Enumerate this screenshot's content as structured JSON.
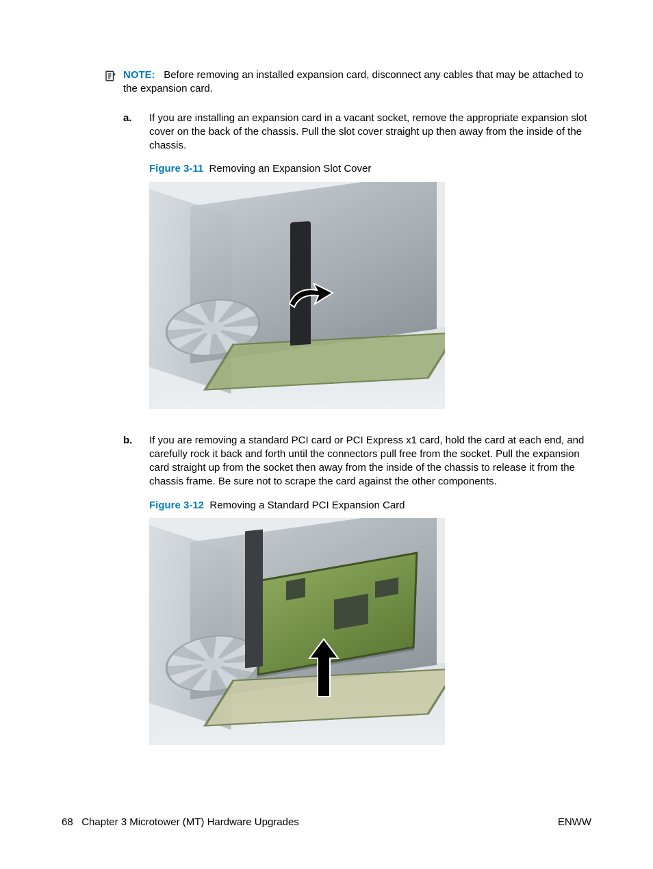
{
  "note": {
    "label": "NOTE:",
    "text": "Before removing an installed expansion card, disconnect any cables that may be attached to the expansion card."
  },
  "items": {
    "a": {
      "marker": "a.",
      "text": "If you are installing an expansion card in a vacant socket, remove the appropriate expansion slot cover on the back of the chassis. Pull the slot cover straight up then away from the inside of the chassis.",
      "figure": {
        "num": "Figure 3-11",
        "caption": "Removing an Expansion Slot Cover"
      }
    },
    "b": {
      "marker": "b.",
      "text": "If you are removing a standard PCI card or PCI Express x1 card, hold the card at each end, and carefully rock it back and forth until the connectors pull free from the socket. Pull the expansion card straight up from the socket then away from the inside of the chassis to release it from the chassis frame. Be sure not to scrape the card against the other components.",
      "figure": {
        "num": "Figure 3-12",
        "caption": "Removing a Standard PCI Expansion Card"
      }
    }
  },
  "footer": {
    "page": "68",
    "chapter": "Chapter 3   Microtower (MT) Hardware Upgrades",
    "lang": "ENWW"
  }
}
